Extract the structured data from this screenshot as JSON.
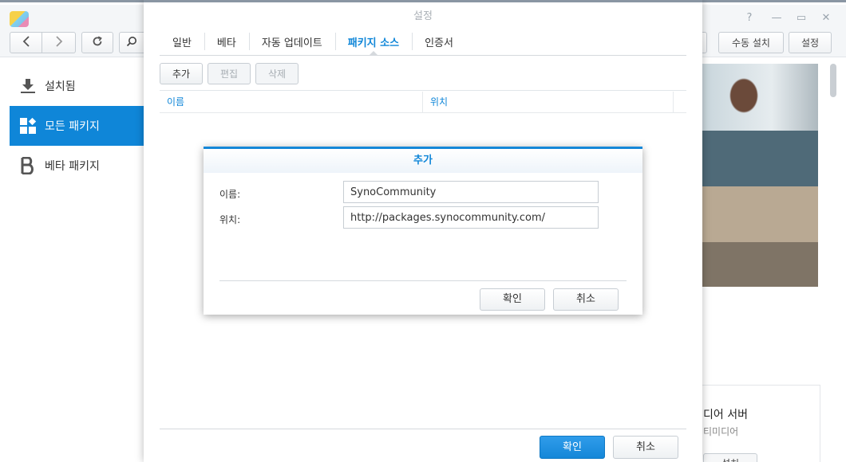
{
  "app": {
    "toolbar": {
      "manual_install_label": "수동 설치",
      "settings_label": "설정"
    },
    "sidebar": {
      "items": [
        {
          "label": "설치됨",
          "icon": "download-icon"
        },
        {
          "label": "모든 패키지",
          "icon": "grid-icon",
          "active": true
        },
        {
          "label": "베타 패키지",
          "icon": "beta-icon"
        }
      ]
    },
    "media_card": {
      "title": "디어 서버",
      "subtitle": "티미디어",
      "button_label": "설치"
    }
  },
  "settings_dialog": {
    "title": "설정",
    "tabs": [
      {
        "label": "일반"
      },
      {
        "label": "베타"
      },
      {
        "label": "자동 업데이트"
      },
      {
        "label": "패키지 소스",
        "active": true
      },
      {
        "label": "인증서"
      }
    ],
    "actions": {
      "add_label": "추가",
      "edit_label": "편집",
      "delete_label": "삭제"
    },
    "columns": {
      "name": "이름",
      "location": "위치"
    },
    "footer": {
      "ok_label": "확인",
      "cancel_label": "취소"
    }
  },
  "add_dialog": {
    "title": "추가",
    "name_label": "이름:",
    "name_value": "SynoCommunity",
    "location_label": "위치:",
    "location_value": "http://packages.synocommunity.com/",
    "ok_label": "확인",
    "cancel_label": "취소"
  },
  "colors": {
    "accent": "#0f86d8",
    "sidebar_active_bg": "#0f86d8",
    "window_border": "#8a96a3"
  }
}
